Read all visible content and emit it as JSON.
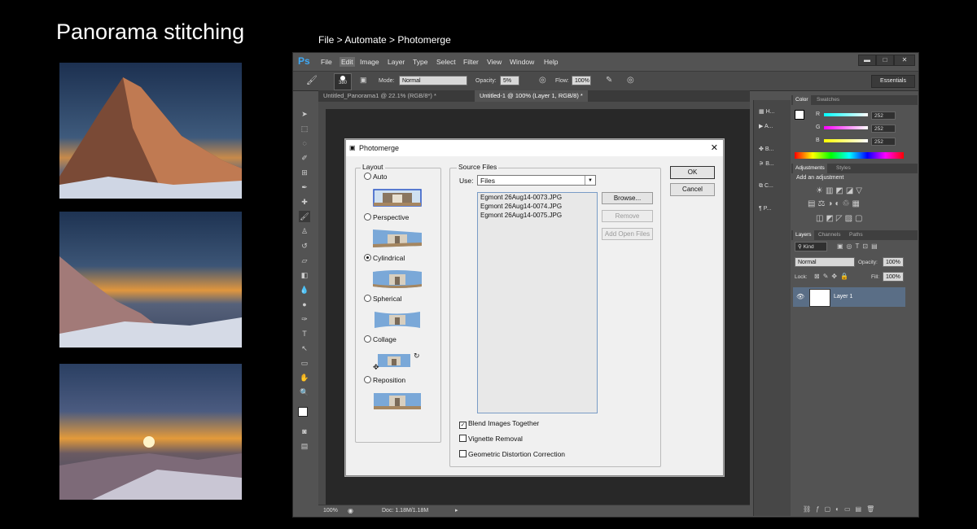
{
  "slide": {
    "title": "Panorama stitching",
    "subtitle": "File > Automate > Photomerge"
  },
  "app": {
    "logo": "Ps",
    "menus": [
      "File",
      "Edit",
      "Image",
      "Layer",
      "Type",
      "Select",
      "Filter",
      "View",
      "Window",
      "Help"
    ],
    "active_menu": "Edit",
    "window_buttons": [
      "▬",
      "□",
      "✕"
    ],
    "options": {
      "brush_size": "380",
      "mode_label": "Mode:",
      "mode_value": "Normal",
      "opacity_label": "Opacity:",
      "opacity_value": "5%",
      "flow_label": "Flow:",
      "flow_value": "100%"
    },
    "workspace": "Essentials",
    "tabs": [
      {
        "label": "Untitled_Panorama1 @ 22.1% (RGB/8*) *"
      },
      {
        "label": "Untitled-1 @ 100% (Layer 1, RGB/8) *"
      }
    ],
    "status": {
      "zoom": "100%",
      "doc": "Doc: 1.18M/1.18M"
    },
    "panel_strip": [
      "H...",
      "A...",
      "B...",
      "B...",
      "C...",
      "P..."
    ],
    "color_panel": {
      "tabs": [
        "Color",
        "Swatches"
      ],
      "channels": [
        {
          "label": "R",
          "value": "252"
        },
        {
          "label": "G",
          "value": "252"
        },
        {
          "label": "B",
          "value": "252"
        }
      ]
    },
    "adjustments_panel": {
      "tabs": [
        "Adjustments",
        "Styles"
      ],
      "heading": "Add an adjustment"
    },
    "layers_panel": {
      "tabs": [
        "Layers",
        "Channels",
        "Paths"
      ],
      "filter": "Kind",
      "blend_mode": "Normal",
      "opacity_label": "Opacity:",
      "opacity_value": "100%",
      "lock_label": "Lock:",
      "fill_label": "Fill:",
      "fill_value": "100%",
      "layer_name": "Layer 1"
    }
  },
  "dialog": {
    "title": "Photomerge",
    "layout_group": "Layout",
    "layouts": [
      {
        "label": "Auto",
        "selected": false
      },
      {
        "label": "Perspective",
        "selected": false
      },
      {
        "label": "Cylindrical",
        "selected": true
      },
      {
        "label": "Spherical",
        "selected": false
      },
      {
        "label": "Collage",
        "selected": false
      },
      {
        "label": "Reposition",
        "selected": false
      }
    ],
    "source_group": "Source Files",
    "use_label": "Use:",
    "use_value": "Files",
    "files": [
      "Egmont 26Aug14-0073.JPG",
      "Egmont 26Aug14-0074.JPG",
      "Egmont 26Aug14-0075.JPG"
    ],
    "buttons": {
      "browse": "Browse...",
      "remove": "Remove",
      "add_open": "Add Open Files",
      "ok": "OK",
      "cancel": "Cancel"
    },
    "options": [
      {
        "label": "Blend Images Together",
        "checked": true
      },
      {
        "label": "Vignette Removal",
        "checked": false
      },
      {
        "label": "Geometric Distortion Correction",
        "checked": false
      }
    ]
  }
}
